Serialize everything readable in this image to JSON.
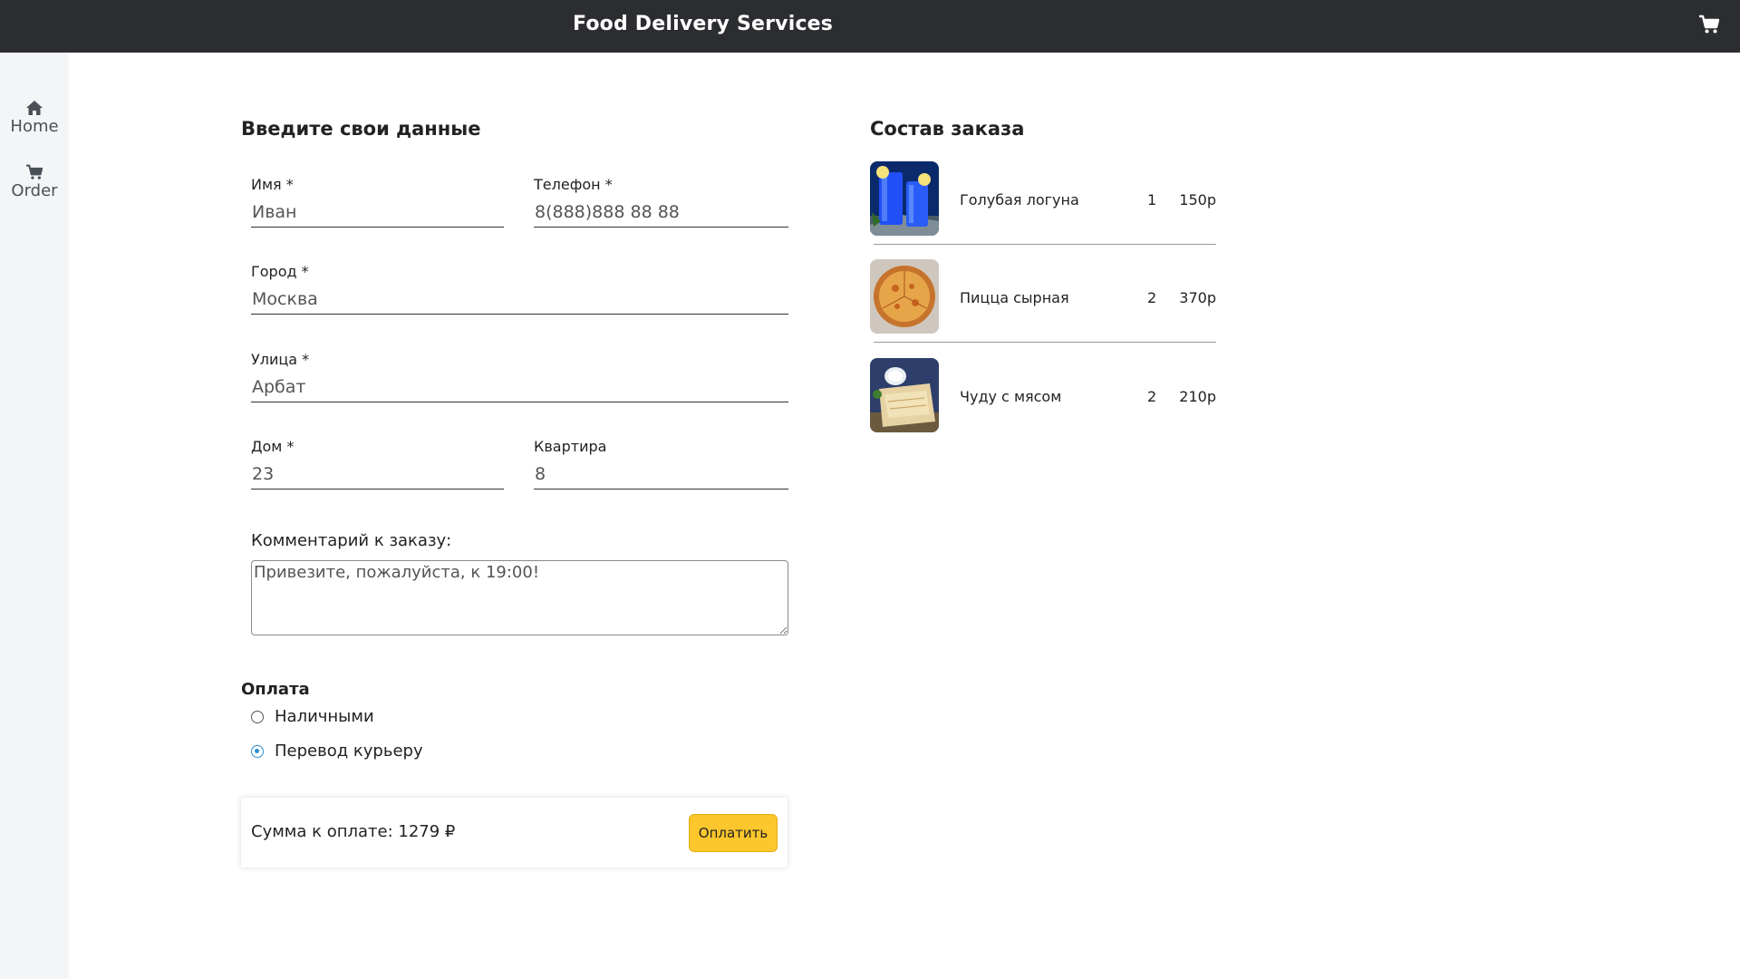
{
  "header": {
    "title": "Food Delivery Services",
    "cart_icon": "shopping-cart-icon"
  },
  "sidebar": {
    "items": [
      {
        "label": "Home",
        "icon": "home-icon"
      },
      {
        "label": "Order",
        "icon": "shopping-cart-icon"
      }
    ]
  },
  "form": {
    "title": "Введите свои данные",
    "name": {
      "label": "Имя *",
      "value": "Иван"
    },
    "phone": {
      "label": "Телефон *",
      "value": "8(888)888 88 88"
    },
    "city": {
      "label": "Город *",
      "value": "Москва"
    },
    "street": {
      "label": "Улица *",
      "value": "Арбат"
    },
    "house": {
      "label": "Дом *",
      "value": "23"
    },
    "apartment": {
      "label": "Квартира",
      "value": "8"
    },
    "comment": {
      "label": "Комментарий к заказу:",
      "value": "Привезите, пожалуйста, к 19:00!"
    }
  },
  "payment": {
    "title": "Оплата",
    "options": [
      {
        "label": "Наличными",
        "selected": false
      },
      {
        "label": "Перевод курьеру",
        "selected": true
      }
    ],
    "total_text": "Сумма к оплате: 1279 ₽",
    "pay_button": "Оплатить"
  },
  "order": {
    "title": "Состав заказа",
    "items": [
      {
        "name": "Голубая логуна",
        "qty": "1",
        "price": "150р",
        "image": "blue-lagoon-drink-image"
      },
      {
        "name": "Пицца сырная",
        "qty": "2",
        "price": "370р",
        "image": "cheese-pizza-image"
      },
      {
        "name": "Чуду с мясом",
        "qty": "2",
        "price": "210р",
        "image": "chudu-flatbread-image"
      }
    ]
  },
  "colors": {
    "topbar": "#2b2d30",
    "sidebar": "#f4f5f7",
    "pay_button": "#fcc72c",
    "radio_accent": "#2f8fd0"
  }
}
